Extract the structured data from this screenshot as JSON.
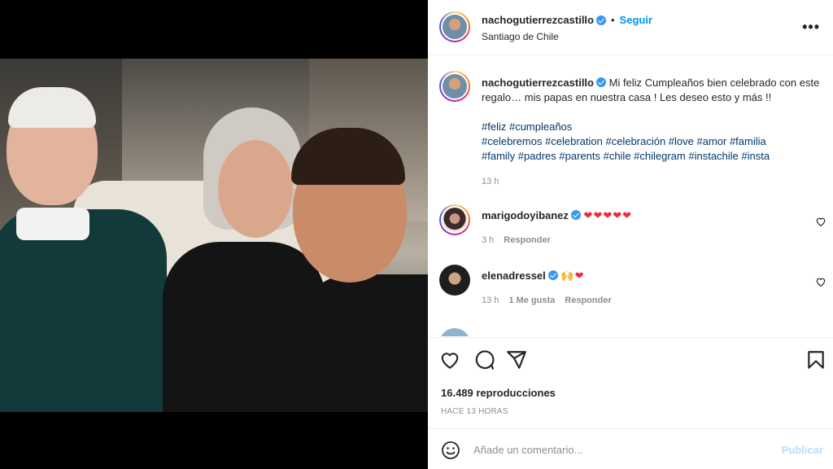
{
  "post": {
    "author": "nachogutierrezcastillo",
    "follow_label": "Seguir",
    "location": "Santiago de Chile",
    "more_label": "•••",
    "caption_text": "Mi feliz Cumpleaños bien celebrado con este regalo… mis papas en nuestra casa ! Les deseo esto y más !!",
    "hashtags_line1": "#feliz #cumpleaños",
    "hashtags_line2": "#celebremos #celebration #celebración #love #amor #familia",
    "hashtags_line3": "#family #padres #parents #chile #chilegram #instachile #insta",
    "caption_time": "13 h",
    "views": "16.489 reproducciones",
    "posted_ago": "HACE 13 HORAS"
  },
  "comments": [
    {
      "user": "marigodoyibanez",
      "text": "❤❤❤❤❤",
      "time": "3 h",
      "likes": "",
      "reply_label": "Responder"
    },
    {
      "user": "elenadressel",
      "text": "🙌❤",
      "time": "13 h",
      "likes": "1 Me gusta",
      "reply_label": "Responder"
    }
  ],
  "add_comment": {
    "placeholder": "Añade un comentario...",
    "publish_label": "Publicar"
  },
  "icons": {
    "like": "heart-icon",
    "comment": "comment-icon",
    "share": "share-icon",
    "save": "bookmark-icon",
    "emoji": "emoji-icon",
    "mute": "muted-speaker-icon"
  },
  "colors": {
    "accent": "#0095f6",
    "hashtag": "#00376b",
    "heart": "#ed2939",
    "muted_text": "#8e8e8e"
  }
}
